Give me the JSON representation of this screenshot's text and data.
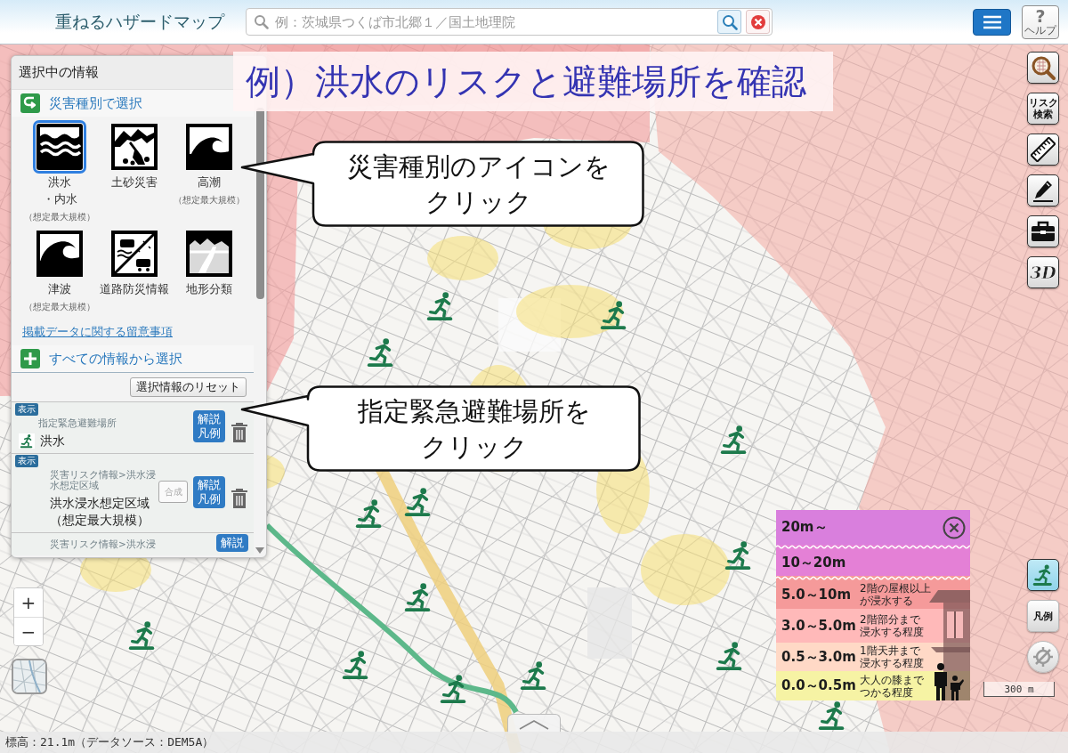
{
  "header": {
    "title": "重ねるハザードマップ",
    "search": {
      "placeholder": "例：茨城県つくば市北郷１／国土地理院"
    },
    "help": {
      "symbol": "?",
      "label": "ヘルプ"
    }
  },
  "annotation": {
    "title": "例）洪水のリスクと避難場所を確認",
    "callouts": [
      {
        "text": "災害種別のアイコンをクリック"
      },
      {
        "text": "指定緊急避難場所をクリック"
      }
    ]
  },
  "panel": {
    "title": "選択中の情報",
    "hazard_section": "災害種別で選択",
    "hazard_types": [
      {
        "kind": "flood",
        "label": "洪水",
        "label_2": "・内水",
        "note": "（想定最大規模）",
        "selected": true
      },
      {
        "kind": "landslide",
        "label": "土砂災害",
        "selected": false
      },
      {
        "kind": "storm_surge",
        "label": "高潮",
        "note": "（想定最大規模）",
        "selected": false
      },
      {
        "kind": "tsunami",
        "label": "津波",
        "note": "（想定最大規模）",
        "selected": false
      },
      {
        "kind": "road",
        "label": "道路防災情報",
        "selected": false
      },
      {
        "kind": "landform",
        "label": "地形分類",
        "selected": false
      }
    ],
    "notice_link": "掲載データに関する留意事項",
    "all_section": "すべての情報から選択",
    "reset_button": "選択情報のリセット",
    "layers": [
      {
        "kind": "point",
        "badge": "表示",
        "category": "指定緊急避難場所",
        "name": "洪水",
        "info_button": "解説凡例",
        "deletable": true
      },
      {
        "kind": "area",
        "badge": "表示",
        "category": "災害リスク情報>洪水浸水想定区域",
        "merge": {
          "label": "合成",
          "disabled": true
        },
        "name": "洪水浸水想定区域（想定最大規模）",
        "info_button": "解説凡例",
        "deletable": true
      },
      {
        "kind": "area",
        "category": "災害リスク情報>洪水浸",
        "info_button": "解説"
      }
    ]
  },
  "legend": {
    "rows": [
      {
        "depth": "20m～",
        "color": "#d97fdd"
      },
      {
        "depth": "10～20m",
        "color": "#e480d6"
      },
      {
        "depth": "5.0～10m",
        "note": [
          "2階の屋根以上",
          "が浸水する"
        ],
        "color": "#f59a9a"
      },
      {
        "depth": "3.0～5.0m",
        "note": [
          "2階部分まで",
          "浸水する程度"
        ],
        "color": "#ffb9b9"
      },
      {
        "depth": "0.5～3.0m",
        "note": [
          "1階天井まで",
          "浸水する程度"
        ],
        "color": "#ffd9c6"
      },
      {
        "depth": "0.0～0.5m",
        "note": [
          "大人の膝まで",
          "つかる程度"
        ],
        "color": "#f6f3a4"
      }
    ]
  },
  "tools": [
    {
      "kind": "zoom_search"
    },
    {
      "kind": "risk_search",
      "label": "リスク検索"
    },
    {
      "kind": "ruler"
    },
    {
      "kind": "pencil"
    },
    {
      "kind": "toolbox"
    },
    {
      "kind": "perspective",
      "label": "3D"
    }
  ],
  "map_controls": [
    {
      "kind": "evacuation",
      "on": true
    },
    {
      "kind": "legend",
      "label": "凡例"
    },
    {
      "kind": "locate"
    }
  ],
  "zoom": {
    "in": "+",
    "out": "−"
  },
  "scale": "300 m",
  "status_bar": "標高：21.1m（データソース：DEM5A）"
}
